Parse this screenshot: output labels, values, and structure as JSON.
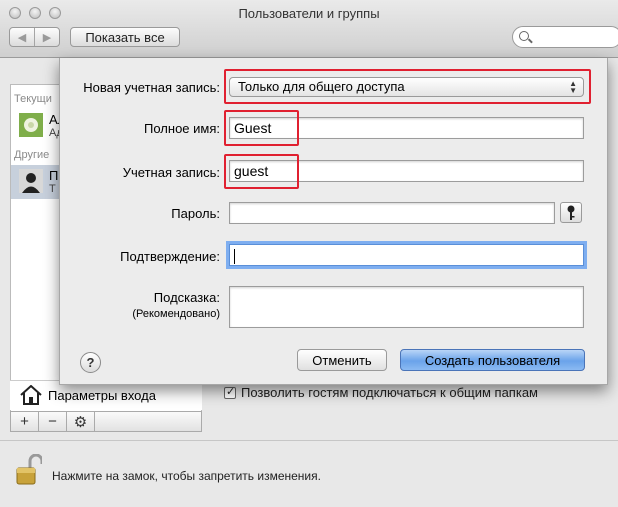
{
  "window": {
    "title": "Пользователи и группы"
  },
  "toolbar": {
    "show_all": "Показать все",
    "back": "◀",
    "forward": "▶"
  },
  "sidebar": {
    "current_heading": "Текущи",
    "other_heading": "Другие",
    "current_user_name": "Але",
    "current_user_role": "Адм",
    "selected_user_name": "П",
    "selected_user_sub": "Т",
    "login_options": "Параметры входа",
    "add": "+",
    "remove": "−",
    "gear": "⚙"
  },
  "background": {
    "guest_shared_folders": "Позволить гостям подключаться к общим папкам",
    "lock_text": "Нажмите на замок, чтобы запретить изменения."
  },
  "sheet": {
    "new_account_label": "Новая учетная запись:",
    "new_account_value": "Только для общего доступа",
    "full_name_label": "Полное имя:",
    "full_name_value": "Guest",
    "account_label": "Учетная запись:",
    "account_value": "guest",
    "password_label": "Пароль:",
    "password_value": "",
    "verify_label": "Подтверждение:",
    "verify_value": "",
    "hint_label": "Подсказка:",
    "hint_sublabel": "(Рекомендовано)",
    "hint_value": "",
    "help": "?",
    "cancel": "Отменить",
    "create": "Создать пользователя"
  },
  "colors": {
    "highlight_box": "#e02030",
    "default_button": "#6aa3ea",
    "focus_ring": "#7eaef0"
  }
}
